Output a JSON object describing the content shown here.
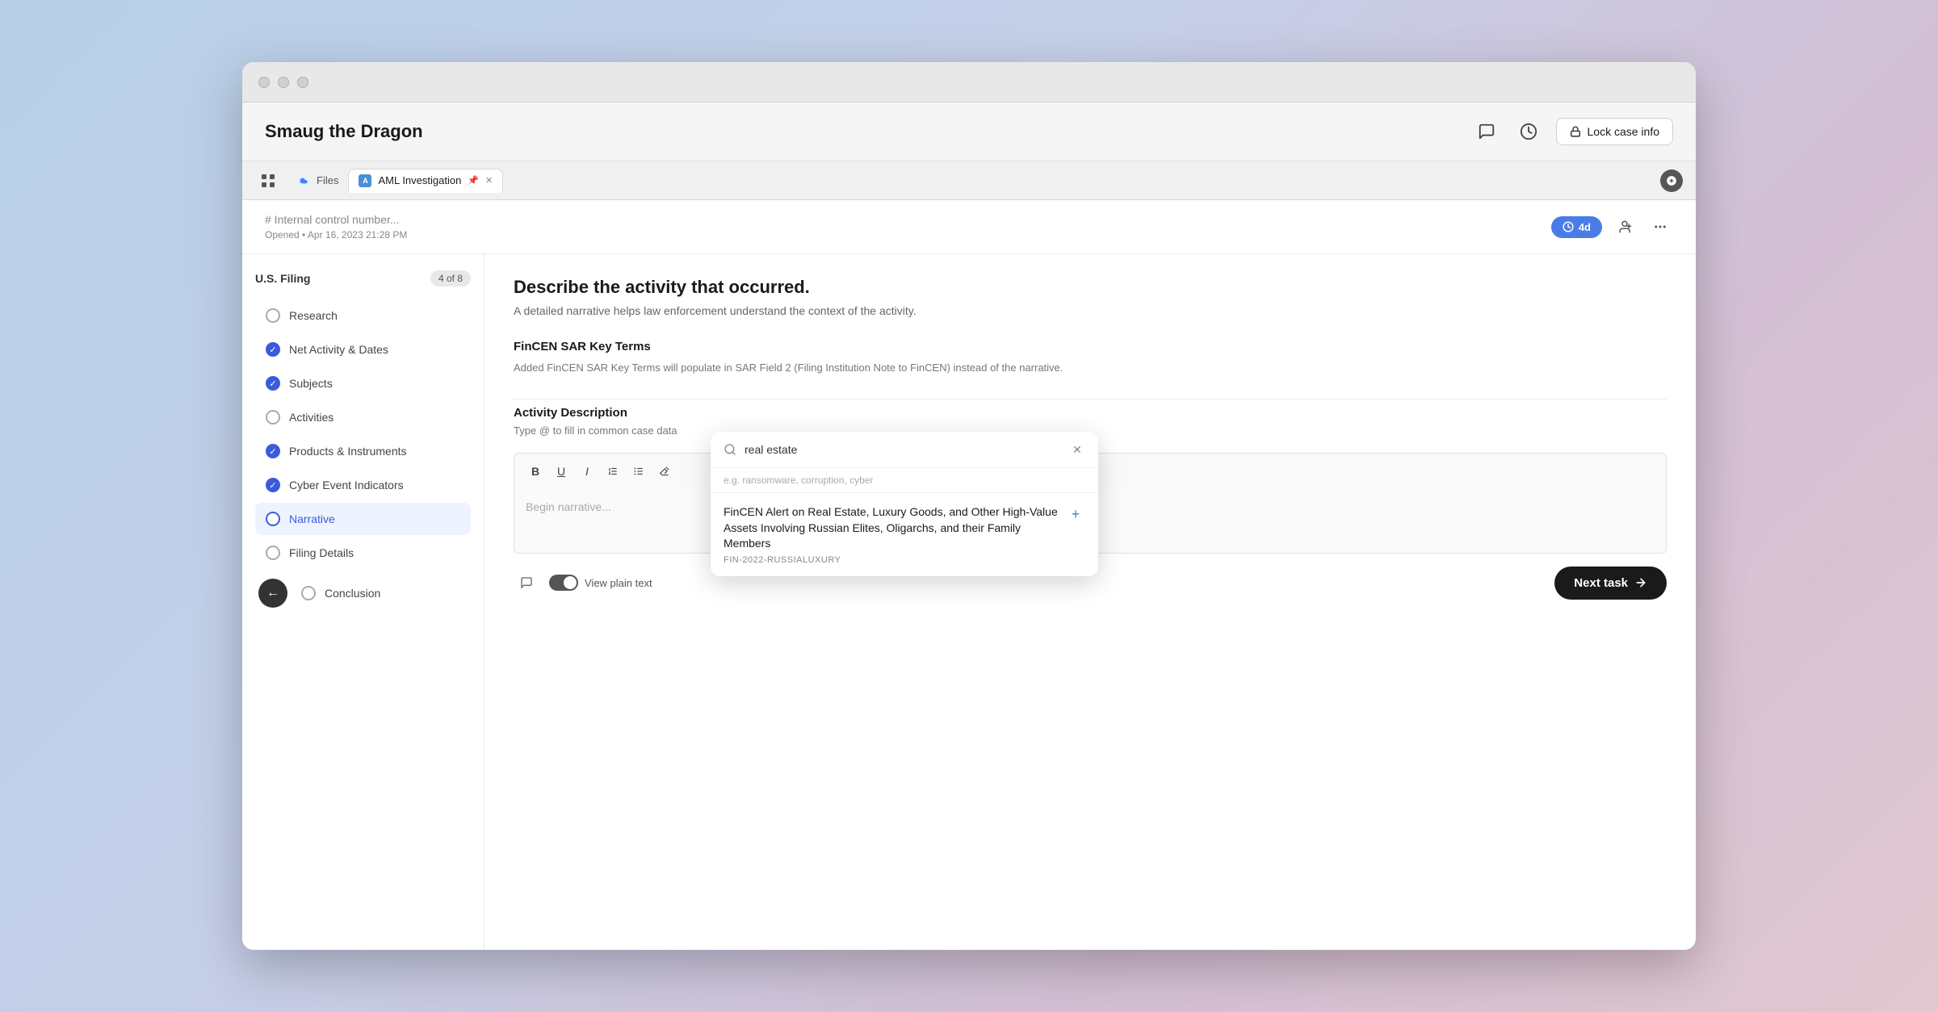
{
  "window": {
    "title": "Smaug the Dragon"
  },
  "header": {
    "title": "Smaug the Dragon",
    "lock_btn": "Lock case info",
    "chat_icon": "💬",
    "history_icon": "🕐"
  },
  "tabs": {
    "files_label": "Files",
    "aml_label": "AML Investigation",
    "plus_icon": "+"
  },
  "form_header": {
    "control_number_placeholder": "# Internal control number...",
    "opened_label": "Opened • Apr 16, 2023 21:28 PM",
    "time_badge": "4d",
    "assign_icon": "👤",
    "more_icon": "⋯"
  },
  "sidebar": {
    "section_title": "U.S. Filing",
    "progress": "4 of 8",
    "items": [
      {
        "label": "Research",
        "status": "empty"
      },
      {
        "label": "Net Activity & Dates",
        "status": "checked"
      },
      {
        "label": "Subjects",
        "status": "checked"
      },
      {
        "label": "Activities",
        "status": "empty"
      },
      {
        "label": "Products & Instruments",
        "status": "checked"
      },
      {
        "label": "Cyber Event Indicators",
        "status": "checked"
      },
      {
        "label": "Narrative",
        "status": "active"
      },
      {
        "label": "Filing Details",
        "status": "empty"
      },
      {
        "label": "Conclusion",
        "status": "empty"
      }
    ]
  },
  "main": {
    "section_title": "Describe the activity that occurred.",
    "section_subtitle": "A detailed narrative helps law enforcement understand the context of the activity.",
    "key_terms": {
      "label": "FinCEN SAR Key Terms",
      "hint": "Added FinCEN SAR Key Terms will populate in SAR Field 2 (Filing Institution Note to FinCEN) instead of the narrative."
    },
    "activity_desc": {
      "label": "Activity Description",
      "hint": "Type @ to fill in common case data"
    },
    "toolbar": {
      "bold": "B",
      "italic": "I",
      "underline": "U",
      "ordered_list": "≡",
      "unordered_list": "≡",
      "clear": "✕"
    },
    "editor_placeholder": "Begin narrative...",
    "view_plain_text": "View plain text",
    "next_task_btn": "Next task"
  },
  "search_popup": {
    "query": "real estate",
    "placeholder": "e.g. ransomware, corruption, cyber",
    "result": {
      "title": "FinCEN Alert on Real Estate, Luxury Goods, and Other High-Value Assets Involving Russian Elites, Oligarchs, and their Family Members",
      "code": "FIN-2022-RUSSIALUXURY"
    }
  }
}
